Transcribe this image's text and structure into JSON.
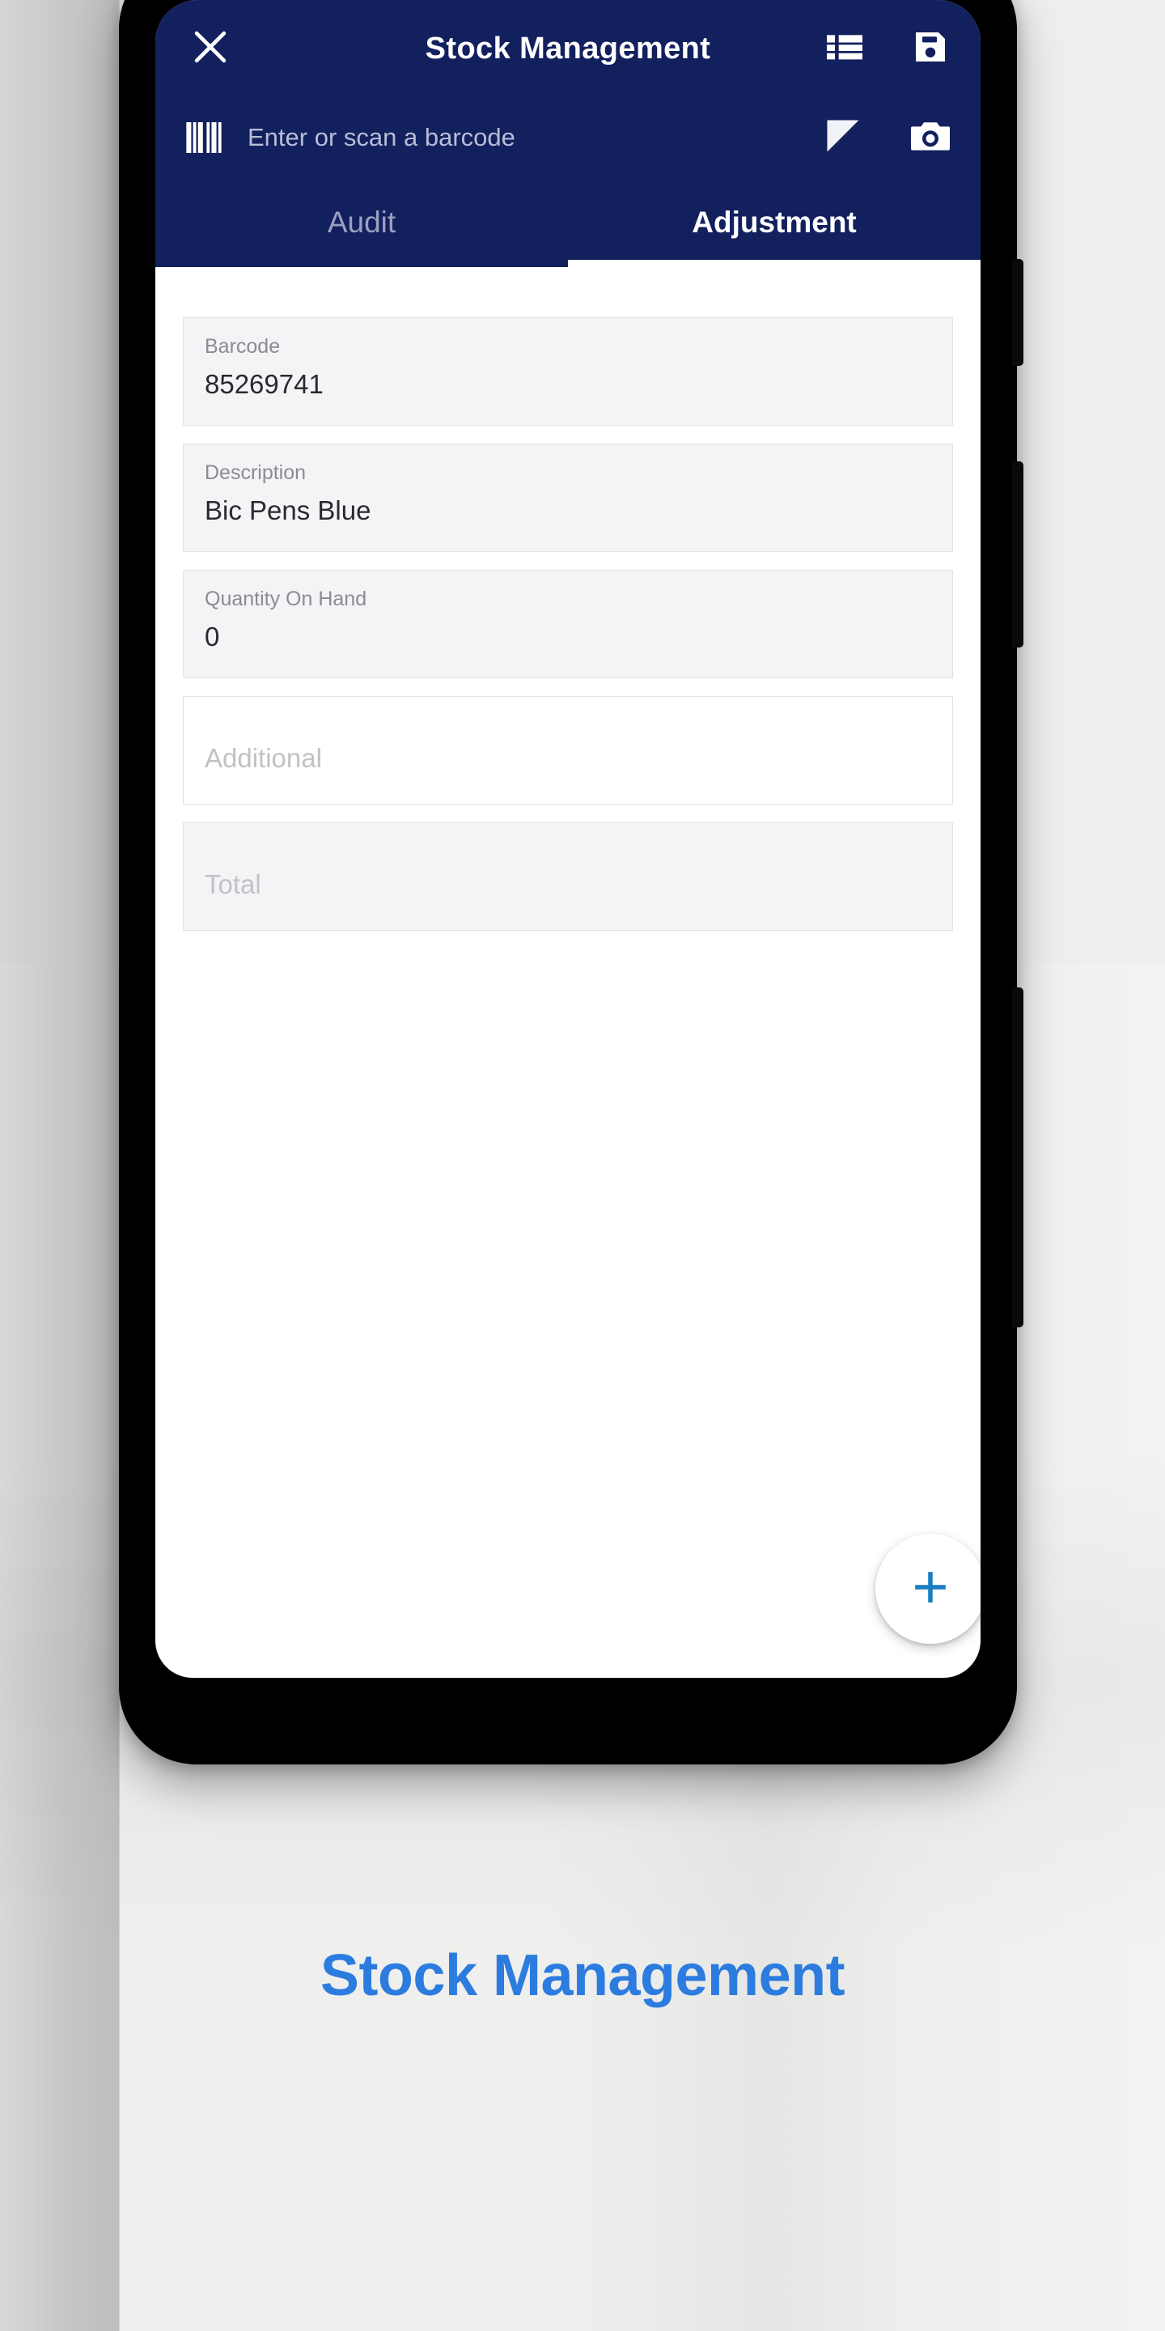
{
  "theme": {
    "appbar_bg": "#13205e",
    "page_bg": "#efefed",
    "accent_blue": "#1a7fc1",
    "caption_blue": "#2c7ce0",
    "active_tab_color": "#ffffff",
    "inactive_tab_color": "#9aa0c0",
    "field_bg_filled": "#f4f4f7",
    "field_border": "#e3e3e6"
  },
  "appbar": {
    "title": "Stock Management",
    "close_icon": "close-icon",
    "list_icon": "list-view-icon",
    "save_icon": "save-floppy-icon"
  },
  "barcode_bar": {
    "icon": "barcode-icon",
    "placeholder": "Enter or scan a barcode",
    "value": "",
    "filter_icon": "filter-triangle-icon",
    "camera_icon": "camera-icon"
  },
  "tabs": [
    {
      "label": "Audit",
      "active": false
    },
    {
      "label": "Adjustment",
      "active": true
    }
  ],
  "form": {
    "fields": [
      {
        "label": "Barcode",
        "value": "85269741",
        "placeholder": "",
        "state": "filled"
      },
      {
        "label": "Description",
        "value": "Bic Pens Blue",
        "placeholder": "",
        "state": "filled"
      },
      {
        "label": "Quantity On Hand",
        "value": "0",
        "placeholder": "",
        "state": "filled"
      },
      {
        "label": "",
        "value": "",
        "placeholder": "Additional",
        "state": "empty"
      },
      {
        "label": "",
        "value": "",
        "placeholder": "Total",
        "state": "empty-grey"
      }
    ]
  },
  "fab": {
    "icon": "plus-icon",
    "label": "+"
  },
  "caption": {
    "text": "Stock Management"
  }
}
